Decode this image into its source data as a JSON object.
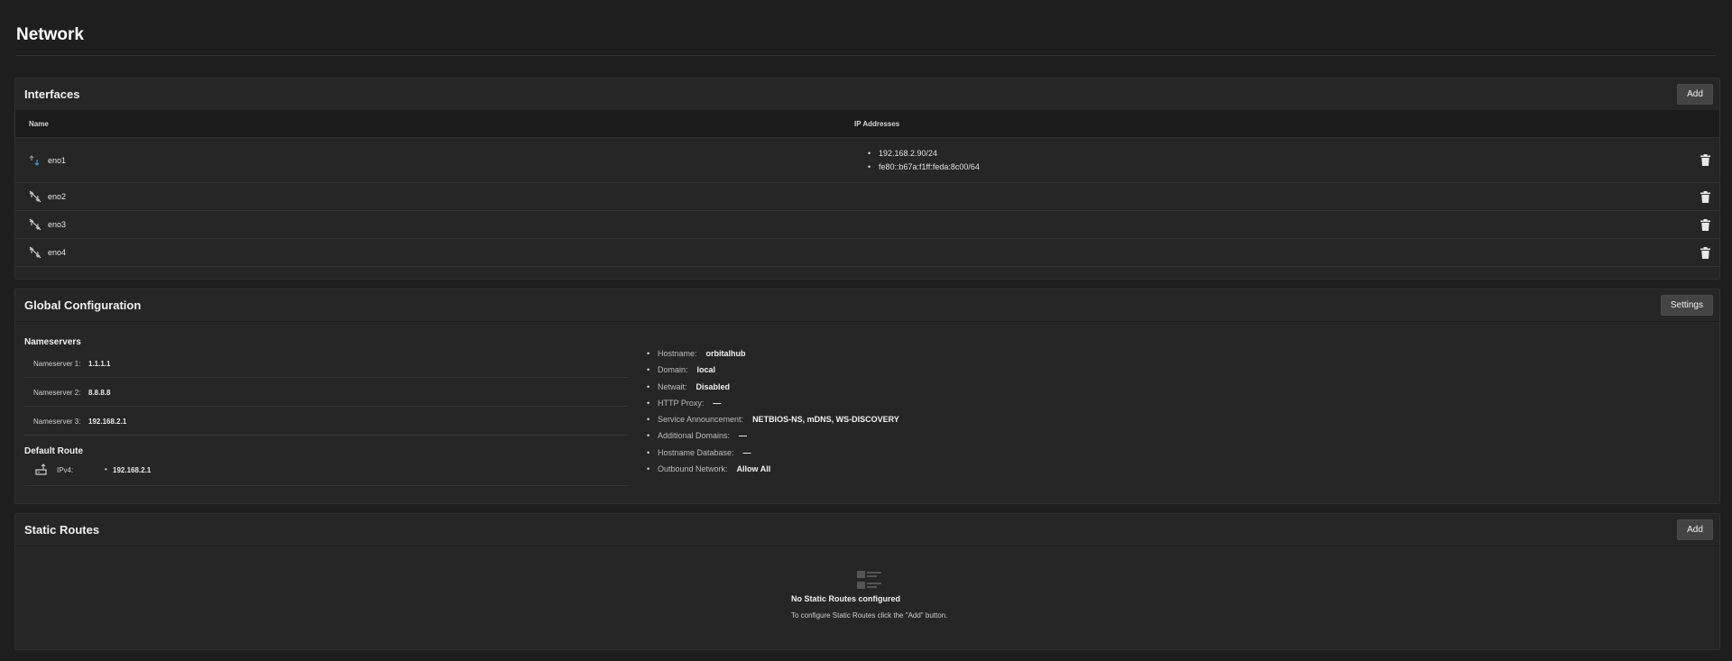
{
  "page": {
    "title": "Network"
  },
  "interfaces": {
    "title": "Interfaces",
    "add_label": "Add",
    "columns": {
      "name": "Name",
      "ip": "IP Addresses"
    },
    "rows": [
      {
        "name": "eno1",
        "status_icon": "link-up-icon",
        "ips": [
          "192.168.2.90/24",
          "fe80::b67a:f1ff:feda:8c00/64"
        ]
      },
      {
        "name": "eno2",
        "status_icon": "link-down-icon",
        "ips": []
      },
      {
        "name": "eno3",
        "status_icon": "link-down-icon",
        "ips": []
      },
      {
        "name": "eno4",
        "status_icon": "link-down-icon",
        "ips": []
      }
    ]
  },
  "global": {
    "title": "Global Configuration",
    "settings_label": "Settings",
    "nameservers_title": "Nameservers",
    "nameservers": [
      {
        "label": "Nameserver 1:",
        "value": "1.1.1.1"
      },
      {
        "label": "Nameserver 2:",
        "value": "8.8.8.8"
      },
      {
        "label": "Nameserver 3:",
        "value": "192.168.2.1"
      }
    ],
    "default_route_title": "Default Route",
    "default_route": {
      "label": "IPv4:",
      "value": "192.168.2.1"
    },
    "info": [
      {
        "label": "Hostname:",
        "value": "orbitalhub"
      },
      {
        "label": "Domain:",
        "value": "local"
      },
      {
        "label": "Netwait:",
        "value": "Disabled"
      },
      {
        "label": "HTTP Proxy:",
        "value": "—"
      },
      {
        "label": "Service Announcement:",
        "value": "NETBIOS-NS, mDNS, WS-DISCOVERY"
      },
      {
        "label": "Additional Domains:",
        "value": "—"
      },
      {
        "label": "Hostname Database:",
        "value": "—"
      },
      {
        "label": "Outbound Network:",
        "value": "Allow All"
      }
    ]
  },
  "static_routes": {
    "title": "Static Routes",
    "add_label": "Add",
    "empty_title": "No Static Routes configured",
    "empty_message": "To configure Static Routes click the \"Add\" button."
  },
  "colors": {
    "background": "#1e1e1e",
    "card": "#262626",
    "button": "#444444",
    "link_up": "#3a8fd0"
  }
}
